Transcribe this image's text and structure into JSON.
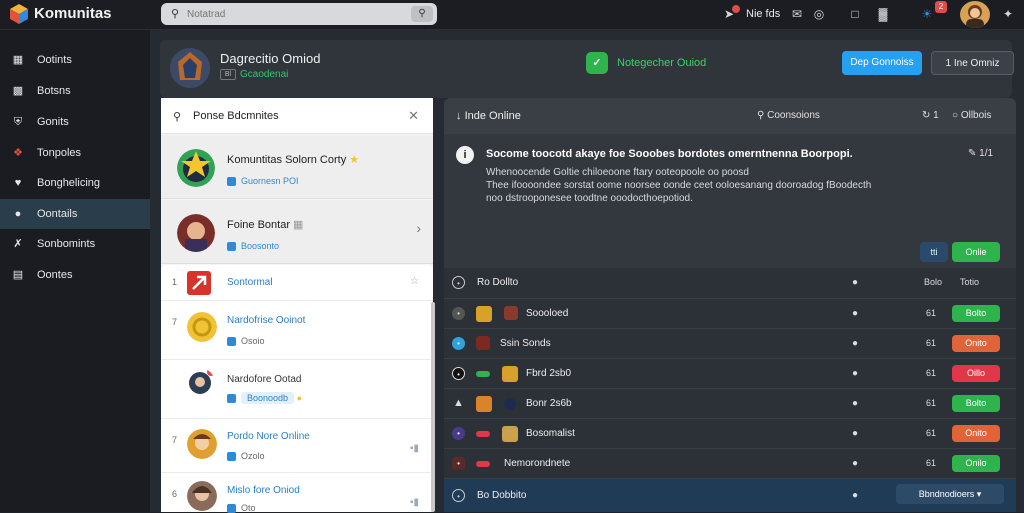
{
  "app": {
    "name": "Komunitas"
  },
  "search": {
    "placeholder": "Notatrad"
  },
  "topbar": {
    "nav_label": "Nie fds",
    "alert_count": "2"
  },
  "sidebar": {
    "items": [
      {
        "label": "Ootints",
        "icon": "chat-icon"
      },
      {
        "label": "Botsns",
        "icon": "bot-icon"
      },
      {
        "label": "Gonits",
        "icon": "shield-icon"
      },
      {
        "label": "Tonpoles",
        "icon": "puzzle-icon"
      },
      {
        "label": "Bonghelicing",
        "icon": "heart-icon"
      },
      {
        "label": "Oontails",
        "icon": "gamepad-icon"
      },
      {
        "label": "Sonbomints",
        "icon": "sword-icon"
      },
      {
        "label": "Oontes",
        "icon": "chart-icon"
      }
    ]
  },
  "hero": {
    "name": "Dagrecitio Omiod",
    "tag": "Bl",
    "sub": "Gcaodenai"
  },
  "online_badge": {
    "text": "Notegecher Ouiod"
  },
  "buttons": {
    "primary": "Dep Gonnoiss",
    "secondary": "1 Ine Omniz"
  },
  "left_panel": {
    "title": "Ponse Bdcmnites",
    "featured": [
      {
        "name": "Komuntitas Solorn Corty",
        "sub": "Guornesn POI"
      },
      {
        "name": "Foine Bontar",
        "sub": "Boosonto"
      }
    ],
    "list": [
      {
        "num": "1",
        "name": "Sontormal",
        "sub": ""
      },
      {
        "num": "7",
        "name": "Nardofrise Ooinot",
        "sub": "Osoio"
      },
      {
        "num": "3",
        "name": "Nardofore Ootad",
        "sub": "Boonoodb"
      },
      {
        "num": "7",
        "name": "Pordo Nore Online",
        "sub": "Ozolo"
      },
      {
        "num": "6",
        "name": "Mislo fore Oniod",
        "sub": "Oto"
      }
    ]
  },
  "right_panel": {
    "title": "Inde Online",
    "mid": "Coonsoions",
    "count": "1",
    "other": "Ollbois",
    "notice": {
      "heading": "Socome toocotd akaye foe Sooobes bordotes omerntnenna Boorpopi.",
      "body": [
        "Whenoocende Goltie chiloeoone ftary ooteopoole oo poosd",
        "Thee ifoooondee sorstat oome noorsee oonde ceet ooloesanang dooroadog fBoodecth",
        "noo dstrooponesee toodtne ooodocthoepotiod."
      ],
      "edit": "1/1",
      "btn1": "tti",
      "btn2": "Onlie"
    },
    "table": {
      "head": {
        "name": "Ro Dollto",
        "col": "Bolo",
        "status": "Totio"
      },
      "rows": [
        {
          "name": "Soooloed",
          "num": "61",
          "status": "Bolto",
          "color": "#2fb34d"
        },
        {
          "name": "Ssin Sonds",
          "num": "61",
          "status": "Onito",
          "color": "#e0633a"
        },
        {
          "name": "Fbrd 2sb0",
          "num": "61",
          "status": "Oillo",
          "color": "#e0384a"
        },
        {
          "name": "Bonr 2s6b",
          "num": "61",
          "status": "Bolto",
          "color": "#2fb34d"
        },
        {
          "name": "Bosomalist",
          "num": "61",
          "status": "Onito",
          "color": "#e0633a"
        },
        {
          "name": "Nemorondnete",
          "num": "61",
          "status": "Onilo",
          "color": "#2fb34d"
        }
      ],
      "foot": {
        "name": "Bo Dobbito",
        "select": "Bbndnodioers"
      }
    }
  }
}
